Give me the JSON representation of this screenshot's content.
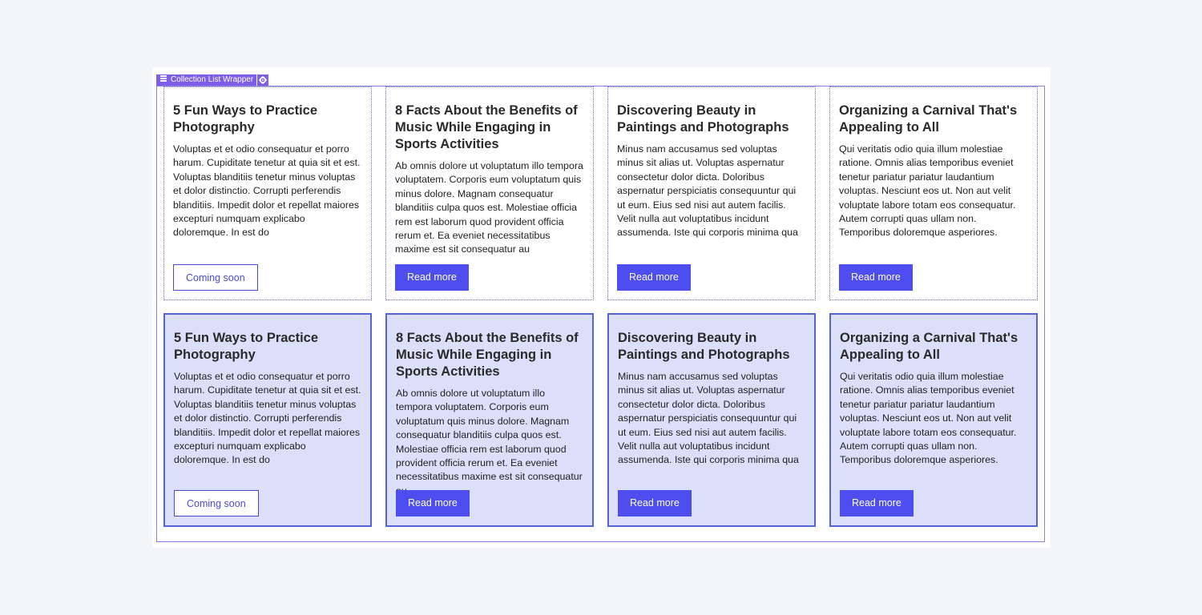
{
  "wrapper": {
    "label": "Collection List Wrapper",
    "icon": "collection-icon",
    "settings_icon": "gear-icon",
    "tag_color": "#7e5ee8"
  },
  "rows": [
    {
      "state": "outline",
      "cards": [
        {
          "title": "5 Fun Ways to Practice Photography",
          "body": "Voluptas et et odio consequatur et porro harum. Cupiditate tenetur at quia sit et est. Voluptas blanditiis tenetur minus voluptas et dolor distinctio. Corrupti perferendis blanditiis. Impedit dolor et repellat maiores excepturi numquam explicabo doloremque. In est do",
          "button": "Coming soon",
          "button_style": "secondary"
        },
        {
          "title": "8 Facts About the Benefits of Music While Engaging in Sports Activities",
          "body": "Ab omnis dolore ut voluptatum illo tempora voluptatem. Corporis eum voluptatum quis minus dolore. Magnam consequatur blanditiis culpa quos est. Molestiae officia rem est laborum quod provident officia rerum et. Ea eveniet necessitatibus maxime est sit consequatur au",
          "button": "Read more",
          "button_style": "primary"
        },
        {
          "title": "Discovering Beauty in Paintings and Photographs",
          "body": "Minus nam accusamus sed voluptas minus sit alias ut. Voluptas aspernatur consectetur dolor dicta. Doloribus aspernatur perspiciatis consequuntur qui ut eum. Eius sed nisi aut autem facilis. Velit nulla aut voluptatibus incidunt assumenda. Iste qui corporis minima qua",
          "button": "Read more",
          "button_style": "primary"
        },
        {
          "title": "Organizing a Carnival That's Appealing to All",
          "body": "Qui veritatis odio quia illum molestiae ratione. Omnis alias temporibus eveniet tenetur pariatur pariatur laudantium voluptas. Nesciunt eos ut. Non aut velit voluptate labore totam eos consequatur. Autem corrupti quas ullam non. Temporibus doloremque asperiores.",
          "button": "Read more",
          "button_style": "primary"
        }
      ]
    },
    {
      "state": "selected",
      "cards": [
        {
          "title": "5 Fun Ways to Practice Photography",
          "body": "Voluptas et et odio consequatur et porro harum. Cupiditate tenetur at quia sit et est. Voluptas blanditiis tenetur minus voluptas et dolor distinctio. Corrupti perferendis blanditiis. Impedit dolor et repellat maiores excepturi numquam explicabo doloremque. In est do",
          "button": "Coming soon",
          "button_style": "secondary"
        },
        {
          "title": "8 Facts About the Benefits of Music While Engaging in Sports Activities",
          "body": "Ab omnis dolore ut voluptatum illo tempora voluptatem. Corporis eum voluptatum quis minus dolore. Magnam consequatur blanditiis culpa quos est. Molestiae officia rem est laborum quod provident officia rerum et. Ea eveniet necessitatibus maxime est sit consequatur au",
          "button": "Read more",
          "button_style": "primary"
        },
        {
          "title": "Discovering Beauty in Paintings and Photographs",
          "body": "Minus nam accusamus sed voluptas minus sit alias ut. Voluptas aspernatur consectetur dolor dicta. Doloribus aspernatur perspiciatis consequuntur qui ut eum. Eius sed nisi aut autem facilis. Velit nulla aut voluptatibus incidunt assumenda. Iste qui corporis minima qua",
          "button": "Read more",
          "button_style": "primary"
        },
        {
          "title": "Organizing a Carnival That's Appealing to All",
          "body": "Qui veritatis odio quia illum molestiae ratione. Omnis alias temporibus eveniet tenetur pariatur pariatur laudantium voluptas. Nesciunt eos ut. Non aut velit voluptate labore totam eos consequatur. Autem corrupti quas ullam non. Temporibus doloremque asperiores.",
          "button": "Read more",
          "button_style": "primary"
        }
      ]
    }
  ],
  "colors": {
    "primary_button": "#4e4ef0",
    "selected_fill": "#dcdff9",
    "selected_border": "#5563d8",
    "outline_border": "#6f6fd8"
  }
}
